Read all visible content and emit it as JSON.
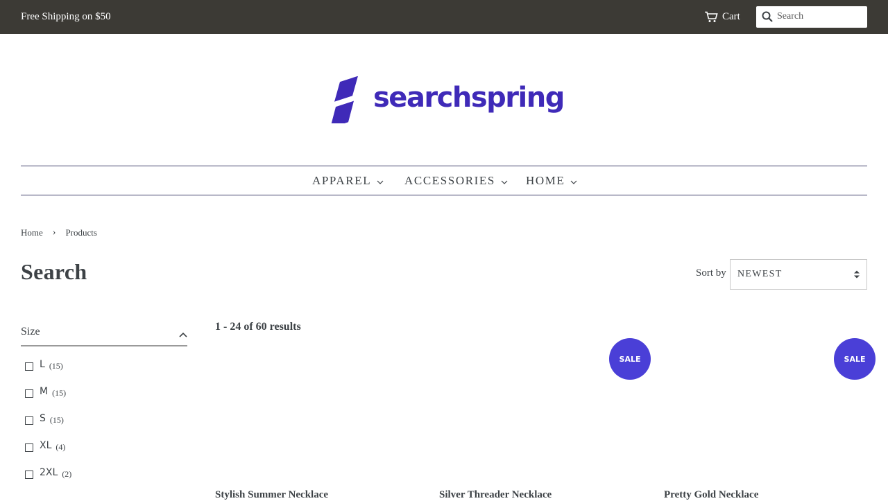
{
  "topbar": {
    "promo": "Free Shipping on $50",
    "cart_label": "Cart",
    "search_placeholder": "Search"
  },
  "logo": {
    "wordmark": "searchspring"
  },
  "nav": {
    "items": [
      {
        "label": "APPAREL"
      },
      {
        "label": "ACCESSORIES"
      },
      {
        "label": "HOME"
      }
    ]
  },
  "breadcrumb": {
    "home": "Home",
    "current": "Products",
    "separator": "›"
  },
  "page": {
    "title": "Search"
  },
  "sort": {
    "label": "Sort by",
    "selected": "NEWEST"
  },
  "facet": {
    "title": "Size",
    "options": [
      {
        "label": "L",
        "count": "(15)"
      },
      {
        "label": "M",
        "count": "(15)"
      },
      {
        "label": "S",
        "count": "(15)"
      },
      {
        "label": "XL",
        "count": "(4)"
      },
      {
        "label": "2XL",
        "count": "(2)"
      }
    ]
  },
  "results": {
    "summary": "1 - 24 of 60 results",
    "products": [
      {
        "name": "Stylish Summer Necklace",
        "badge": ""
      },
      {
        "name": "Silver Threader Necklace",
        "badge": "SALE"
      },
      {
        "name": "Pretty Gold Necklace",
        "badge": "SALE"
      }
    ]
  },
  "colors": {
    "topbar_bg": "#3c3a35",
    "brand": "#3f2ab8",
    "sale_badge": "#4a3fd7",
    "text": "#3d4246"
  }
}
